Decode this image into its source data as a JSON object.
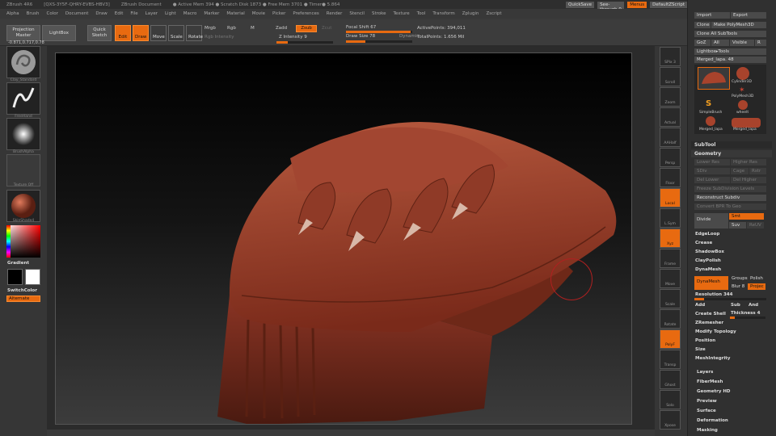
{
  "titlebar": {
    "app": "ZBrush 4R6",
    "code": "[QXS-3Y5F-QHRY-EVBS-HBV3]",
    "doc": "ZBrush Document",
    "mem": "● Active Mem 394 ● Scratch Disk 1873 ● Free Mem 3701 ● Timer● 5.864"
  },
  "topright": {
    "quicksave": "QuickSave",
    "seethrough": "See-through  0",
    "menus": "Menus",
    "script": "DefaultZScript"
  },
  "menubar": [
    "Alpha",
    "Brush",
    "Color",
    "Document",
    "Draw",
    "Edit",
    "File",
    "Layer",
    "Light",
    "Macro",
    "Marker",
    "Material",
    "Movie",
    "Picker",
    "Preferences",
    "Render",
    "Stencil",
    "Stroke",
    "Texture",
    "Tool",
    "Transform",
    "Zplugin",
    "Zscript"
  ],
  "toolbar": {
    "projection_master": "Projection Master",
    "lightbox": "LightBox",
    "quick_sketch": "Quick Sketch",
    "edit": "Edit",
    "draw": "Draw",
    "move": "Move",
    "scale": "Scale",
    "rotate": "Rotate",
    "mrgb": "Mrgb",
    "rgb": "Rgb",
    "m": "M",
    "rgb_intensity": "Rgb Intensity",
    "zadd": "Zadd",
    "zsub": "Zsub",
    "zcut": "Zcut",
    "z_intensity": "Z Intensity 9",
    "focal_shift": "Focal Shift 67",
    "draw_size": "Draw Size 78",
    "dynamic": "Dynamic",
    "active_points": "ActivePoints: 394,011",
    "total_points": "TotalPoints: 1.656 Mil",
    "coords": "-0.871,0.717,0.78"
  },
  "leftshelf": {
    "brush": "Clay_Standard",
    "stroke": "FreeHand",
    "alpha": "BrushAlpha",
    "texture": "Texture Off",
    "material": "SkinShade4",
    "gradient": "Gradient",
    "switchcolor": "SwitchColor",
    "alternate": "Alternate"
  },
  "rightshelf": [
    "SPix 3",
    "Scroll",
    "Zoom",
    "Actual",
    "AAHalf",
    "Persp",
    "Floor",
    "Local",
    "L.Sym",
    "Xyz",
    "Frame",
    "Move",
    "Scale",
    "Rotate",
    "PolyF",
    "Transp",
    "Ghost",
    "Solo",
    "Xpose"
  ],
  "colors": {
    "accent": "#e86a10",
    "clay": "#a8432c"
  },
  "panel": {
    "import": "Import",
    "export": "Export",
    "clone": "Clone",
    "make_polymesh": "Make PolyMesh3D",
    "clone_all": "Clone All SubTools",
    "goz": "GoZ",
    "all": "All",
    "visible": "Visible",
    "r": "R",
    "lightbox_tools": "Lightbox▸Tools",
    "merged_name": "Merged_lapa. 48",
    "tools": [
      "Merged_lapa",
      "Cylinder3D",
      "PolyMesh3D",
      "SimpleBrush",
      "wheelt",
      "Merged_lapa",
      "Merged_lapa"
    ],
    "subtool": "SubTool",
    "geometry": "Geometry",
    "lower_res": "Lower Res",
    "higher_res": "Higher Res",
    "sdiv": "SDiv",
    "cage": "Cage",
    "rstr": "Rstr",
    "del_lower": "Del Lower",
    "del_higher": "Del Higher",
    "freeze": "Freeze SubDivision Levels",
    "reconstruct": "Reconstruct Subdiv",
    "convert_bpr": "Convert BPR To Geo",
    "divide": "Divide",
    "smt": "Smt",
    "suv": "Suv",
    "reuv": "ReUV",
    "edgeloop": "EdgeLoop",
    "crease": "Crease",
    "shadowbox": "ShadowBox",
    "claypolish": "ClayPolish",
    "dynamesh_head": "DynaMesh",
    "dynamesh": "DynaMesh",
    "groups": "Groups",
    "polish": "Polish",
    "blur": "Blur 8",
    "project": "Projec",
    "resolution": "Resolution 344",
    "add": "Add",
    "sub": "Sub",
    "and": "And",
    "create_shell": "Create Shell",
    "thickness": "Thickness 4",
    "zremesher": "ZRemesher",
    "modify_topology": "Modify Topology",
    "position": "Position",
    "size": "Size",
    "meshintegrity": "MeshIntegrity",
    "layers": "Layers",
    "fibermesh": "FiberMesh",
    "geometry_hd": "Geometry HD",
    "preview": "Preview",
    "surface": "Surface",
    "deformation": "Deformation",
    "masking": "Masking"
  }
}
